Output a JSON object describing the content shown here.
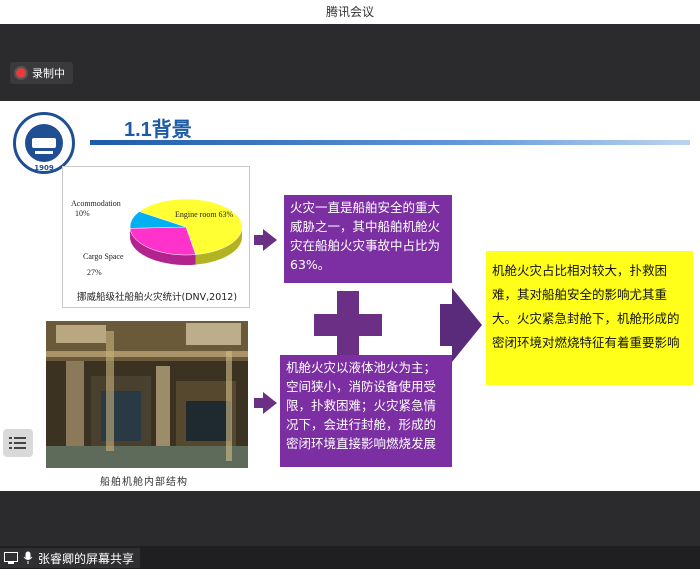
{
  "app": {
    "title": "腾讯会议"
  },
  "recording": {
    "label": "录制中"
  },
  "slide": {
    "title": "1.1背景",
    "logo": {
      "year": "1909"
    },
    "pie": {
      "labels": {
        "accommodation": "Acommodation",
        "accommodation_pct": "10%",
        "engine": "Engine room 63%",
        "cargo": "Cargo Space",
        "cargo_pct": "27%"
      },
      "caption": "挪威船级社船舶火灾统计(DNV,2012)"
    },
    "photo_caption": "船舶机舱内部结构",
    "box_top": "火灾一直是船舶安全的重大威胁之一，其中船舶机舱火灾在船舶火灾事故中占比为63%。",
    "box_bottom": "机舱火灾以液体池火为主；空间狭小，消防设备使用受限，扑救困难；火灾紧急情况下，会进行封舱，形成的密闭环境直接影响燃烧发展",
    "conclusion": "机舱火灾占比相对较大，扑救困难，其对船舶安全的影响尤其重大。火灾紧急封舱下，机舱形成的密闭环境对燃烧特征有着重要影响"
  },
  "chart_data": {
    "type": "pie",
    "title": "挪威船级社船舶火灾统计(DNV,2012)",
    "categories": [
      "Engine room",
      "Cargo Space",
      "Acommodation"
    ],
    "values": [
      63,
      27,
      10
    ],
    "colors": [
      "#ffff33",
      "#ff33cc",
      "#00b0f0"
    ]
  },
  "share": {
    "label": "张睿卿的屏幕共享"
  }
}
